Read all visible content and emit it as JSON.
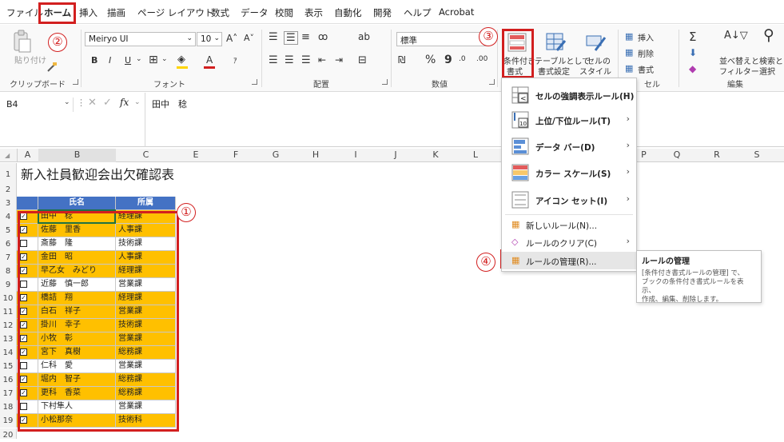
{
  "menu": [
    "ファイル",
    "ホーム",
    "挿入",
    "描画",
    "ページ レイアウト",
    "数式",
    "データ",
    "校閲",
    "表示",
    "自動化",
    "開発",
    "ヘルプ",
    "Acrobat"
  ],
  "ribbon": {
    "paste_label": "貼り付け",
    "clipboard_group": "クリップボード",
    "font_name": "Meiryo UI",
    "font_size": "10",
    "font_group": "フォント",
    "align_group": "配置",
    "number_format": "標準",
    "number_group": "数値",
    "cond_format": [
      "条件付き",
      "書式"
    ],
    "table_format": [
      "テーブルとして",
      "書式設定"
    ],
    "cell_style": [
      "セルの",
      "スタイル"
    ],
    "insert_label": "挿入",
    "delete_label": "削除",
    "format_label": "書式",
    "cells_group": "セル",
    "sort_filter": [
      "並べ替えと",
      "フィルター"
    ],
    "find_select": [
      "検索と",
      "選択"
    ],
    "edit_group": "編集",
    "bold": "B",
    "italic": "I",
    "underline": "U",
    "sigma": "Σ",
    "percent": "%",
    "comma": "9"
  },
  "formula_bar": {
    "cell_ref": "B4",
    "fx": "fx",
    "content": "田中　稔"
  },
  "columns": [
    "A",
    "B",
    "C",
    "E",
    "F",
    "G",
    "H",
    "I",
    "J",
    "K",
    "L",
    "P",
    "Q",
    "R",
    "S"
  ],
  "sheet": {
    "title": "新入社員歓迎会出欠確認表",
    "headers": [
      "氏名",
      "所属"
    ],
    "rows": [
      {
        "check": true,
        "name": "田中　稔",
        "dept": "経理課"
      },
      {
        "check": true,
        "name": "佐藤　里香",
        "dept": "人事課"
      },
      {
        "check": false,
        "name": "斎藤　隆",
        "dept": "技術課"
      },
      {
        "check": true,
        "name": "金田　昭",
        "dept": "人事課"
      },
      {
        "check": true,
        "name": "早乙女　みどり",
        "dept": "経理課"
      },
      {
        "check": false,
        "name": "近藤　慎一郎",
        "dept": "営業課"
      },
      {
        "check": true,
        "name": "橋詰　翔",
        "dept": "経理課"
      },
      {
        "check": true,
        "name": "白石　祥子",
        "dept": "営業課"
      },
      {
        "check": true,
        "name": "掛川　幸子",
        "dept": "技術課"
      },
      {
        "check": true,
        "name": "小牧　彰",
        "dept": "営業課"
      },
      {
        "check": true,
        "name": "宮下　真樹",
        "dept": "総務課"
      },
      {
        "check": false,
        "name": "仁科　愛",
        "dept": "営業課"
      },
      {
        "check": true,
        "name": "堀内　智子",
        "dept": "総務課"
      },
      {
        "check": true,
        "name": "更科　香菜",
        "dept": "総務課"
      },
      {
        "check": false,
        "name": "下村隼人",
        "dept": "営業課"
      },
      {
        "check": true,
        "name": "小松那奈",
        "dept": "技術科"
      }
    ]
  },
  "dropdown": {
    "items": [
      {
        "label": "セルの強調表示ルール(H)",
        "sub": true
      },
      {
        "label": "上位/下位ルール(T)",
        "sub": true
      },
      {
        "label": "データ バー(D)",
        "sub": true
      },
      {
        "label": "カラー スケール(S)",
        "sub": true
      },
      {
        "label": "アイコン セット(I)",
        "sub": true
      },
      {
        "label": "新しいルール(N)...",
        "sub": false
      },
      {
        "label": "ルールのクリア(C)",
        "sub": true
      },
      {
        "label": "ルールの管理(R)...",
        "sub": false
      }
    ]
  },
  "tooltip": {
    "title": "ルールの管理",
    "body": [
      "[条件付き書式ルールの管理] で、",
      "ブックの条件付き書式ルールを表示、",
      "作成、編集、削除します。"
    ]
  },
  "callouts": [
    "①",
    "②",
    "③",
    "④"
  ],
  "colors": {
    "highlight": "#ffc000",
    "header_bg": "#4472c4",
    "annotation": "#d21f1f"
  }
}
